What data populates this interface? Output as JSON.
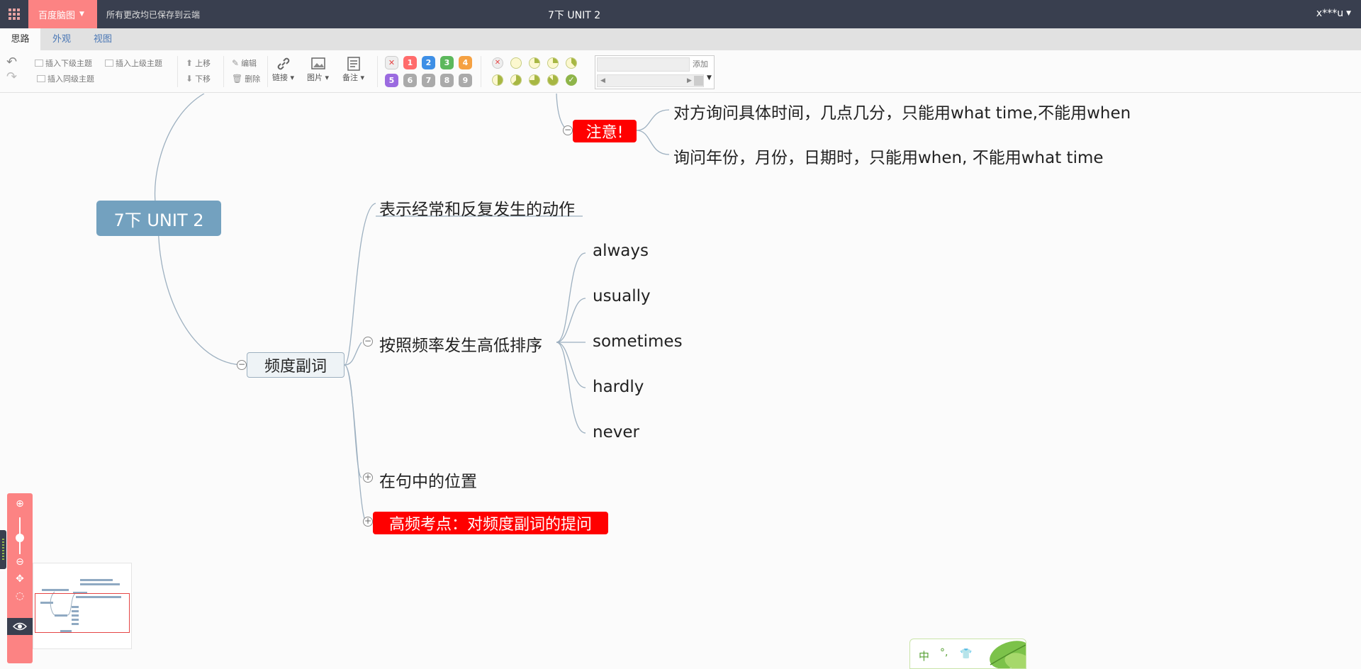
{
  "topbar": {
    "brand": "百度脑图",
    "save_status": "所有更改均已保存到云端",
    "title": "7下 UNIT 2",
    "user": "x***u"
  },
  "tabs": [
    {
      "label": "思路"
    },
    {
      "label": "外观"
    },
    {
      "label": "视图"
    }
  ],
  "toolbar": {
    "insert_child": "插入下级主题",
    "insert_parent": "插入上级主题",
    "insert_sibling": "插入同级主题",
    "move_up": "上移",
    "move_down": "下移",
    "edit": "编辑",
    "delete": "删除",
    "link": "链接",
    "image": "图片",
    "note": "备注",
    "priorities": [
      "1",
      "2",
      "3",
      "4",
      "5",
      "6",
      "7",
      "8",
      "9"
    ],
    "resource_add": "添加"
  },
  "mindmap": {
    "root": "7下 UNIT 2",
    "note_node": "注意!",
    "note_children": [
      "对方询问具体时间，几点几分，只能用what time,不能用when",
      "询问年份，月份，日期时，只能用when, 不能用what time"
    ],
    "main_node": "频度副词",
    "sub_nodes": {
      "meaning": "表示经常和反复发生的动作",
      "order": "按照频率发生高低排序",
      "position": "在句中的位置",
      "key_point": "高频考点：对频度副词的提问"
    },
    "order_children": [
      "always",
      "usually",
      "sometimes",
      "hardly",
      "never"
    ]
  },
  "ime": {
    "mode": "中",
    "punctuation": "°,"
  },
  "colors": {
    "topbar": "#393f4f",
    "brand": "#fc8383",
    "root": "#73a1bf",
    "alert": "#ff0000"
  }
}
